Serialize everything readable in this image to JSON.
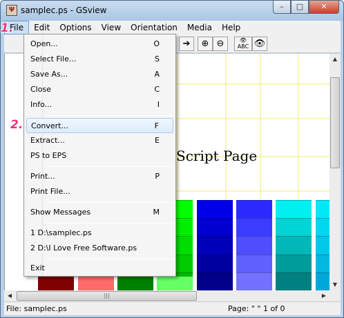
{
  "window": {
    "title": "samplec.ps - GSview",
    "buttons": {
      "minimize": "–",
      "maximize": "□",
      "close": "✕"
    }
  },
  "menubar": {
    "items": [
      "File",
      "Edit",
      "Options",
      "View",
      "Orientation",
      "Media",
      "Help"
    ]
  },
  "toolbar": {
    "icons": [
      "arrow-right-icon",
      "zoom-in-icon",
      "zoom-out-icon",
      "eye-abc-icon",
      "eye-icon"
    ],
    "eye_abc_label": "ABC"
  },
  "file_menu": {
    "items": [
      {
        "label": "Open...",
        "shortcut": "O"
      },
      {
        "label": "Select File...",
        "shortcut": "S"
      },
      {
        "label": "Save As...",
        "shortcut": "A"
      },
      {
        "label": "Close",
        "shortcut": "C"
      },
      {
        "label": "Info...",
        "shortcut": "I"
      },
      {
        "label": "Convert...",
        "shortcut": "F"
      },
      {
        "label": "Extract...",
        "shortcut": "E"
      },
      {
        "label": "PS to EPS",
        "shortcut": ""
      },
      {
        "label": "Print...",
        "shortcut": "P"
      },
      {
        "label": "Print File...",
        "shortcut": ""
      },
      {
        "label": "Show Messages",
        "shortcut": "M"
      },
      {
        "label": "1 D:\\samplec.ps",
        "shortcut": ""
      },
      {
        "label": "2 D:\\I Love Free Software.ps",
        "shortcut": ""
      },
      {
        "label": "Exit",
        "shortcut": ""
      }
    ]
  },
  "document": {
    "heading_fragment": "Script Page",
    "swatch_colors": [
      [
        "#00ff00",
        "#00ee00",
        "#00dd00",
        "#00cc00",
        "#00bb00"
      ],
      [
        "#0000e8",
        "#0000d0",
        "#0000b8",
        "#0000a0",
        "#000088"
      ],
      [
        "#2a2aff",
        "#3c3cff",
        "#4e4eff",
        "#6060ff",
        "#7272ff"
      ],
      [
        "#00f0f0",
        "#00d4d4",
        "#00b8b8",
        "#009c9c",
        "#008080"
      ],
      [
        "#00e8f8",
        "#00d8f0",
        "#00c8e8",
        "#00b8e0",
        "#00a8d8"
      ]
    ],
    "bottom_strip_colors": [
      "#800000",
      "#ff6a6a",
      "#008000",
      "#66ff66"
    ]
  },
  "scrollbar": {
    "thumb_grip": "|||"
  },
  "statusbar": {
    "file": "File: samplec.ps",
    "page": "Page: \" \"  1 of 0"
  },
  "annotations": {
    "step1": "1.",
    "step2": "2."
  },
  "colors": {
    "highlight": "#cde0f4",
    "callout": "#e8337a"
  }
}
